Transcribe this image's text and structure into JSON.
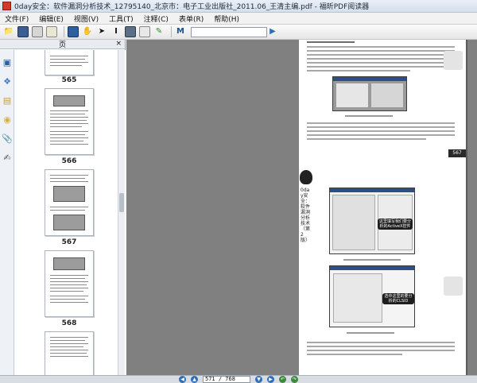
{
  "window": {
    "title": "0day安全：软件漏洞分析技术_12795140_北京市：电子工业出版社_2011.06_王清主编.pdf - 福昕PDF阅读器"
  },
  "menu": {
    "items": [
      {
        "label": "文件(F)"
      },
      {
        "label": "编辑(E)"
      },
      {
        "label": "视图(V)"
      },
      {
        "label": "工具(T)"
      },
      {
        "label": "注释(C)"
      },
      {
        "label": "表单(R)"
      },
      {
        "label": "帮助(H)"
      }
    ]
  },
  "toolbar": {
    "icons": [
      "open-icon",
      "save-icon",
      "print-icon",
      "email-icon",
      "fullscreen-icon",
      "hand-tool-icon",
      "select-icon",
      "text-select-icon",
      "snapshot-icon",
      "typewriter-icon",
      "highlight-icon",
      "find-icon"
    ],
    "search_placeholder": ""
  },
  "panel": {
    "title": "页",
    "close": "×",
    "tabs": [
      "pages-icon",
      "bookmarks-icon",
      "layers-icon",
      "comments-icon",
      "attachments-icon",
      "signatures-icon"
    ],
    "thumbnails": [
      {
        "label": "565"
      },
      {
        "label": "566"
      },
      {
        "label": "567"
      },
      {
        "label": "568"
      }
    ]
  },
  "page": {
    "side_text": "0day安全：软件漏洞分析技术（第2版）",
    "page_tag": "567",
    "callout1": "这里填写我们要分析的ActiveX控件",
    "callout2": "选中这里的要分析的CLSID"
  },
  "status": {
    "current_page": "571",
    "total_pages": "768",
    "page_display": "571 / 768"
  },
  "colors": {
    "accent": "#2c6fb8",
    "viewer_bg": "#808080"
  }
}
